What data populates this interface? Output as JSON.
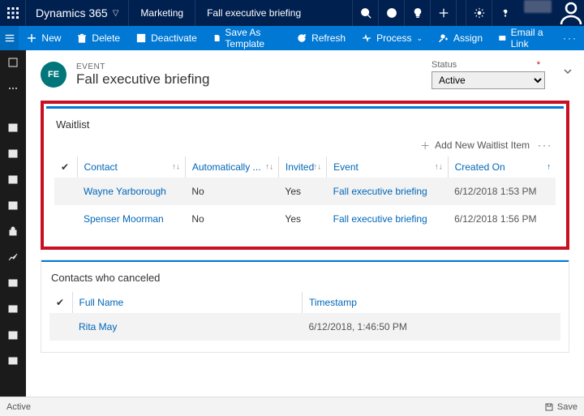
{
  "top": {
    "app": "Dynamics 365",
    "area": "Marketing",
    "breadcrumb": "Fall executive briefing"
  },
  "commands": {
    "new": "New",
    "delete": "Delete",
    "deactivate": "Deactivate",
    "saveas": "Save As Template",
    "refresh": "Refresh",
    "process": "Process",
    "assign": "Assign",
    "email": "Email a Link"
  },
  "record": {
    "initials": "FE",
    "entity": "EVENT",
    "name": "Fall executive briefing",
    "status_label": "Status",
    "status_value": "Active"
  },
  "waitlist": {
    "title": "Waitlist",
    "add_label": "Add New Waitlist Item",
    "columns": {
      "contact": "Contact",
      "auto": "Automatically ...",
      "invited": "Invited",
      "event": "Event",
      "created": "Created On"
    },
    "rows": [
      {
        "contact": "Wayne Yarborough",
        "auto": "No",
        "invited": "Yes",
        "event": "Fall executive briefing",
        "created": "6/12/2018 1:53 PM"
      },
      {
        "contact": "Spenser Moorman",
        "auto": "No",
        "invited": "Yes",
        "event": "Fall executive briefing",
        "created": "6/12/2018 1:56 PM"
      }
    ]
  },
  "canceled": {
    "title": "Contacts who canceled",
    "columns": {
      "fullname": "Full Name",
      "timestamp": "Timestamp"
    },
    "rows": [
      {
        "fullname": "Rita May",
        "timestamp": "6/12/2018, 1:46:50 PM"
      }
    ]
  },
  "footer": {
    "status": "Active",
    "save": "Save"
  }
}
